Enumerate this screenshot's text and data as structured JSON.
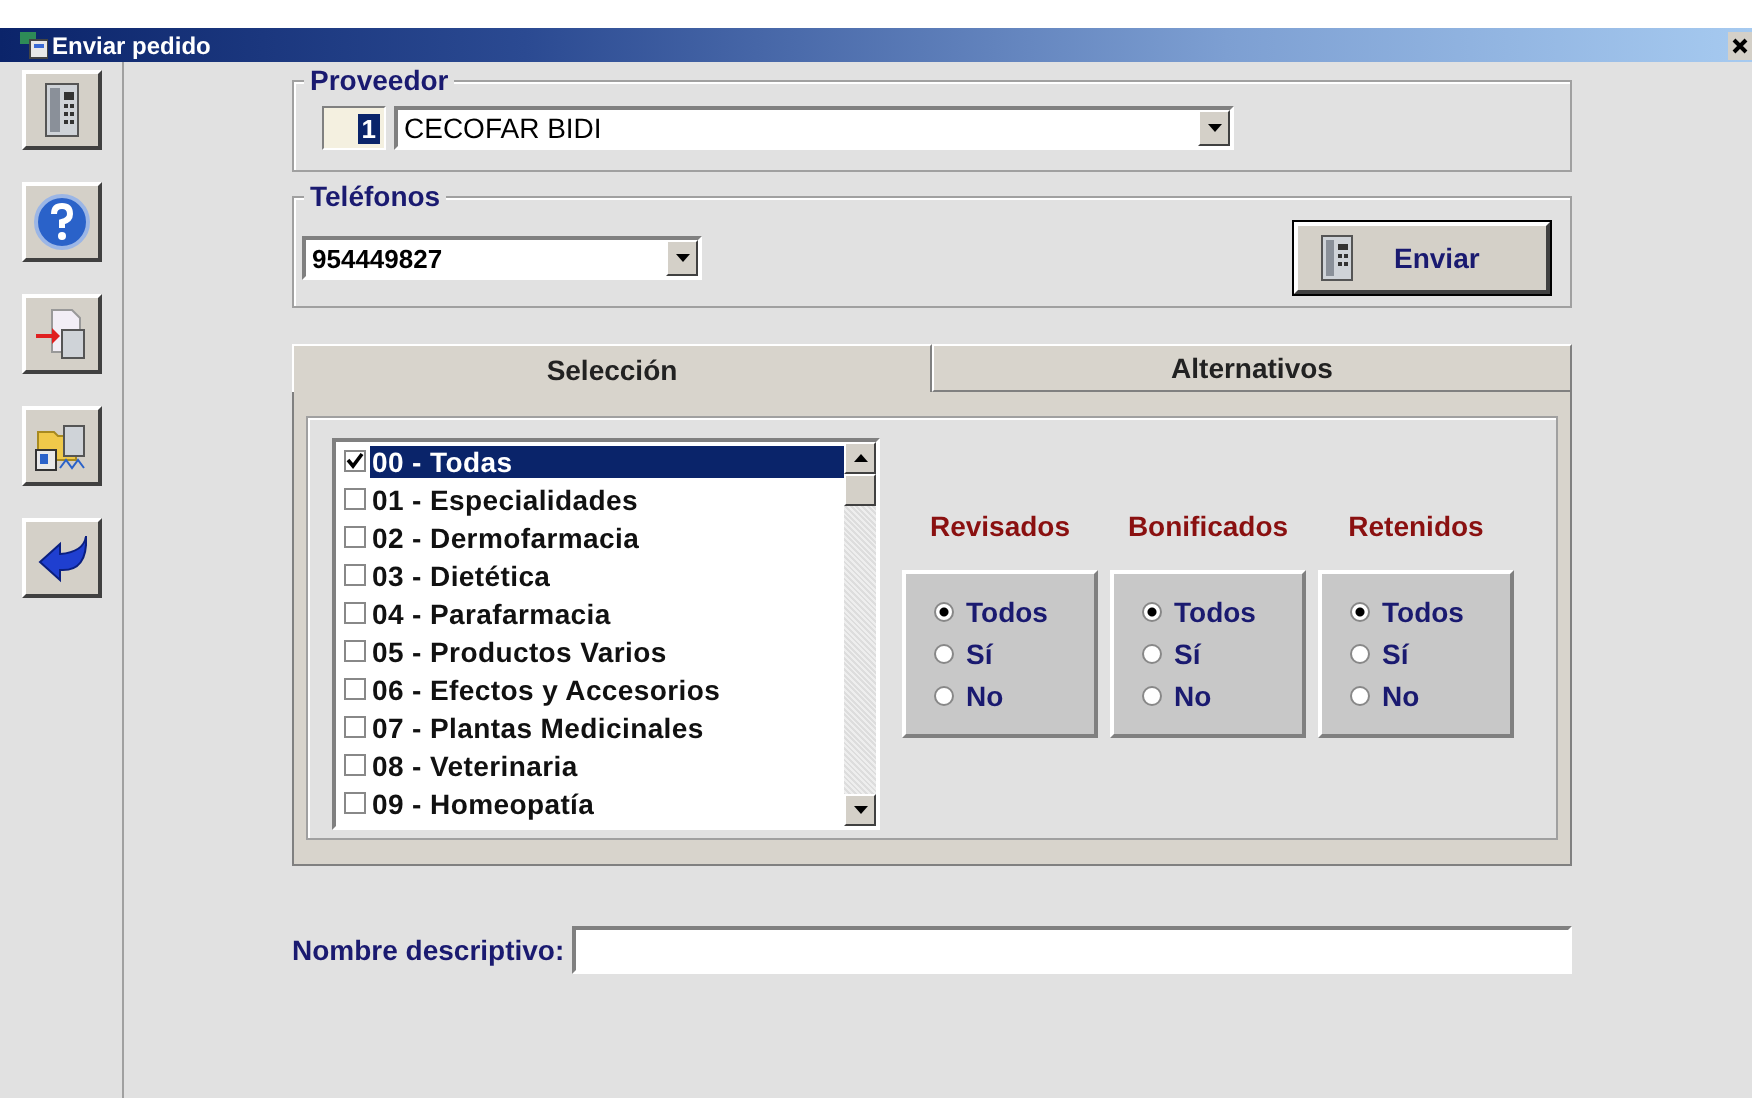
{
  "window": {
    "title": "Enviar pedido"
  },
  "toolbar": [
    {
      "kind": "phone"
    },
    {
      "kind": "help"
    },
    {
      "kind": "send"
    },
    {
      "kind": "folder"
    },
    {
      "kind": "back"
    }
  ],
  "proveedor": {
    "label": "Proveedor",
    "code": "1",
    "value": "CECOFAR BIDI"
  },
  "telefonos": {
    "label": "Teléfonos",
    "value": "954449827"
  },
  "send_button": {
    "label": "Enviar"
  },
  "tabs": [
    {
      "label": "Selección",
      "selected": true
    },
    {
      "label": "Alternativos",
      "selected": false
    }
  ],
  "categories": [
    {
      "label": "00 - Todas",
      "checked": true,
      "selected": true
    },
    {
      "label": "01 - Especialidades",
      "checked": false,
      "selected": false
    },
    {
      "label": "02 - Dermofarmacia",
      "checked": false,
      "selected": false
    },
    {
      "label": "03 - Dietética",
      "checked": false,
      "selected": false
    },
    {
      "label": "04 - Parafarmacia",
      "checked": false,
      "selected": false
    },
    {
      "label": "05 - Productos Varios",
      "checked": false,
      "selected": false
    },
    {
      "label": "06 - Efectos y Accesorios",
      "checked": false,
      "selected": false
    },
    {
      "label": "07 - Plantas Medicinales",
      "checked": false,
      "selected": false
    },
    {
      "label": "08 - Veterinaria",
      "checked": false,
      "selected": false
    },
    {
      "label": "09 - Homeopatía",
      "checked": false,
      "selected": false
    }
  ],
  "filters": [
    {
      "title": "Revisados",
      "options": [
        {
          "label": "Todos",
          "selected": true
        },
        {
          "label": "Sí",
          "selected": false
        },
        {
          "label": "No",
          "selected": false
        }
      ]
    },
    {
      "title": "Bonificados",
      "options": [
        {
          "label": "Todos",
          "selected": true
        },
        {
          "label": "Sí",
          "selected": false
        },
        {
          "label": "No",
          "selected": false
        }
      ]
    },
    {
      "title": "Retenidos",
      "options": [
        {
          "label": "Todos",
          "selected": true
        },
        {
          "label": "Sí",
          "selected": false
        },
        {
          "label": "No",
          "selected": false
        }
      ]
    }
  ],
  "nombre": {
    "label": "Nombre descriptivo:"
  }
}
